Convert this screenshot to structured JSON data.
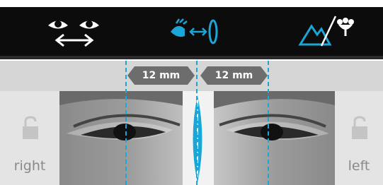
{
  "toolbar": {
    "buttons": [
      {
        "name": "eye-distance-icon",
        "active": false
      },
      {
        "name": "eye-to-lens-distance-icon",
        "active": true
      },
      {
        "name": "landscape-near-far-icon",
        "active": true
      }
    ]
  },
  "measurements": {
    "left_value": "12 mm",
    "right_value": "12 mm"
  },
  "sides": {
    "right_label": "right",
    "left_label": "left"
  },
  "colors": {
    "accent": "#1aa7d8",
    "toolbar_bg": "#0c0c0c",
    "pill_bg": "#6d6d6d"
  }
}
